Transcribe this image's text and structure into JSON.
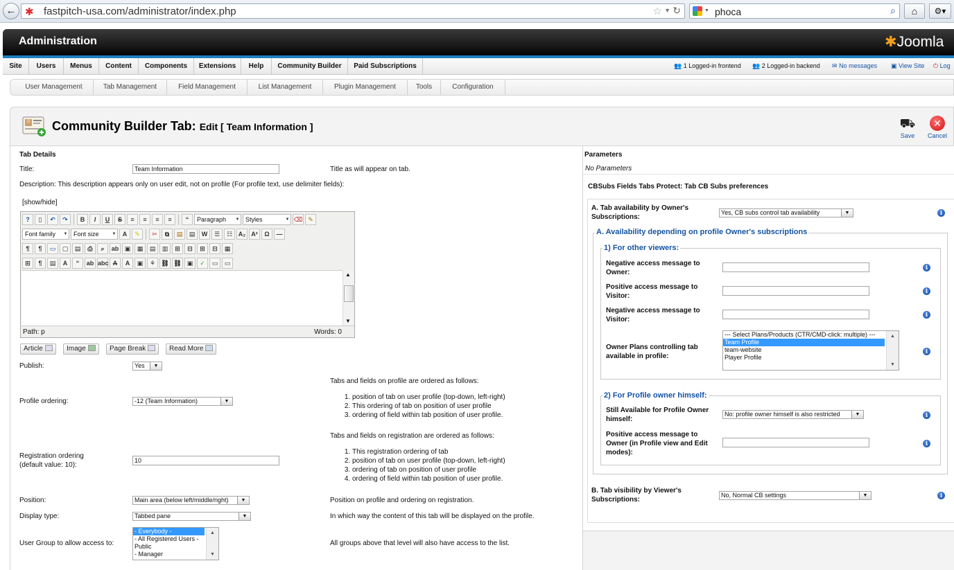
{
  "browser": {
    "url": "fastpitch-usa.com/administrator/index.php",
    "search_text": "phoca"
  },
  "admin": {
    "title": "Administration",
    "logo_text": "Joomla"
  },
  "menu": {
    "items": [
      "Site",
      "Users",
      "Menus",
      "Content",
      "Components",
      "Extensions",
      "Help",
      "Community Builder",
      "Paid Subscriptions"
    ],
    "status": {
      "frontend": "1 Logged-in frontend",
      "backend": "2 Logged-in backend",
      "messages": "No messages",
      "view_site": "View Site",
      "logout": "Log"
    }
  },
  "submenu": {
    "items": [
      "User Management",
      "Tab Management",
      "Field Management",
      "List Management",
      "Plugin Management",
      "Tools",
      "Configuration"
    ]
  },
  "toolbar": {
    "title": "Community Builder Tab:",
    "subtitle": "Edit [ Team Information ]",
    "save_label": "Save",
    "cancel_label": "Cancel"
  },
  "form": {
    "section_title": "Tab Details",
    "title_label": "Title:",
    "title_value": "Team Information",
    "title_help": "Title as will appear on tab.",
    "description_label": "Description: This description appears only on user edit, not on profile (For profile text, use delimiter fields):",
    "show_hide": "[show/hide]",
    "editor": {
      "paragraph": "Paragraph",
      "styles": "Styles",
      "font_family": "Font family",
      "font_size": "Font size",
      "path": "Path: p",
      "words": "Words: 0"
    },
    "editor_buttons": [
      "Article",
      "Image",
      "Page Break",
      "Read More"
    ],
    "publish_label": "Publish:",
    "publish_value": "Yes",
    "profile_ordering_label": "Profile ordering:",
    "profile_ordering_value": "-12 (Team Information)",
    "profile_order_intro": "Tabs and fields on profile are ordered as follows:",
    "profile_order_list": [
      "position of tab on user profile (top-down, left-right)",
      "This ordering of tab on position of user profile",
      "ordering of field within tab position of user profile."
    ],
    "registration_order_intro": "Tabs and fields on registration are ordered as follows:",
    "registration_order_list": [
      "This registration ordering of tab",
      "position of tab on user profile (top-down, left-right)",
      "ordering of tab on position of user profile",
      "ordering of field within tab position of user profile."
    ],
    "registration_ordering_label_1": "Registration ordering",
    "registration_ordering_label_2": "(default value: 10):",
    "registration_ordering_value": "10",
    "position_label": "Position:",
    "position_value": "Main area (below left/middle/right)",
    "position_help": "Position on profile and ordering on registration.",
    "display_type_label": "Display type:",
    "display_type_value": "Tabbed pane",
    "display_type_help": "In which way the content of this tab will be displayed on the profile.",
    "user_group_label": "User Group to allow access to:",
    "user_group_options": [
      "- Everybody -",
      "- All Registered Users -",
      "Public",
      "- Manager"
    ],
    "user_group_help": "All groups above that level will also have access to the list."
  },
  "params": {
    "title": "Parameters",
    "no_params": "No Parameters",
    "cbsubs_title": "CBSubs Fields Tabs Protect: Tab CB Subs preferences",
    "a_label_1": "A. Tab availability by Owner's",
    "a_label_2": "Subscriptions:",
    "a_value": "Yes, CB subs control tab availability",
    "a_legend": "A. Availability depending on profile Owner's subscriptions",
    "other_viewers_legend": "1) For other viewers:",
    "neg_owner_1": "Negative access message to",
    "neg_owner_2": "Owner:",
    "pos_visitor_1": "Positive access message to",
    "pos_visitor_2": "Visitor:",
    "neg_visitor_1": "Negative access message to",
    "neg_visitor_2": "Visitor:",
    "plans_label_1": "Owner Plans controlling tab",
    "plans_label_2": "available in profile:",
    "plans_options": [
      "--- Select Plans/Products (CTR/CMD-click: multiple) ---",
      "Team Profile",
      "team-website",
      "Player Profile"
    ],
    "owner_legend": "2) For Profile owner himself:",
    "still_avail_1": "Still Available for Profile Owner",
    "still_avail_2": "himself:",
    "still_avail_value": "No: profile owner himself is also restricted",
    "pos_owner_1": "Positive access message to",
    "pos_owner_2": "Owner (in Profile view and Edit",
    "pos_owner_3": "modes):",
    "b_label_1": "B. Tab visibility by Viewer's",
    "b_label_2": "Subscriptions:",
    "b_value": "No, Normal CB settings"
  }
}
